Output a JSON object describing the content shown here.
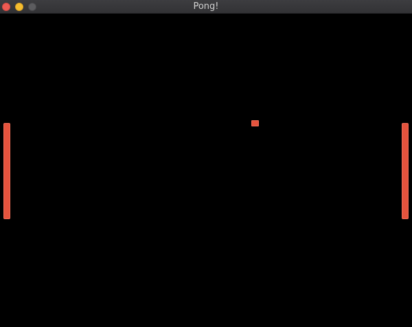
{
  "window": {
    "title": "Pong!",
    "controls": [
      "close",
      "minimize",
      "zoom"
    ]
  },
  "colors": {
    "background": "#000000",
    "paddle": "#e5533d",
    "ball": "#e5533d",
    "titlebar": "#363639",
    "title_text": "#d2d2d2"
  },
  "game": {
    "objects": [
      "left-paddle",
      "right-paddle",
      "ball"
    ]
  }
}
